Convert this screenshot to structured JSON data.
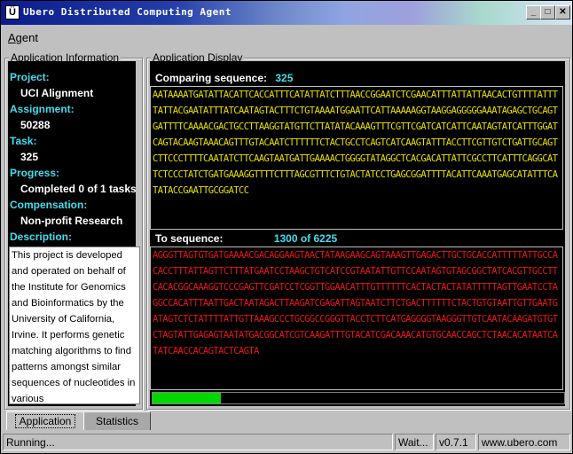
{
  "window": {
    "title": "Ubero Distributed Computing Agent",
    "app_icon": "Ü"
  },
  "menu": {
    "agent_label_first": "A",
    "agent_label_rest": "gent"
  },
  "info": {
    "group_title": "Application Information",
    "project_label": "Project:",
    "project_value": "UCI Alignment",
    "assignment_label": "Assignment:",
    "assignment_value": "50288",
    "task_label": "Task:",
    "task_value": "325",
    "progress_label": "Progress:",
    "progress_value": "Completed 0 of 1 tasks",
    "compensation_label": "Compensation:",
    "compensation_value": "Non-profit Research",
    "description_label": "Description:",
    "description_text": "This project is developed and operated on behalf of the Institute for Genomics and Bioinformatics by the University of California, Irvine.  It performs genetic matching algorithms to find patterns amongst similar sequences of nucleotides in various"
  },
  "display": {
    "group_title": "Application Display",
    "comparing_label": "Comparing sequence:",
    "comparing_value": "325",
    "comparing_sequence": "AATAAAATGATATTACATTCACCATTTCATATTATCTTTAACCGGAATCTCGAACATTTATTATTAACACTGTTTTATTTTATTACGAATATTTATCAATAGTACTTTCTGTAAAATGGAATTCATTAAAAAGGTAAGGAGGGGGAAATAGAGCTGCAGTGATTTTCAAAACGACTGCCTTAAGGTATGTTCTTATATACAAAGTTTCGTTCGATCATCATTCAATAGTATCATTTGGATCAGTACAAGTAAACAGTTTGTACAATCTTTTTTCTACTGCCTCAGTCATCAAGTATTTACCTTCGTTGTCTGATTGCAGTCTTCCCTTTTCAATATCTTCAAGTAATGATTGAAAACTGGGGTATAGGCTCACGACATTATTCGCCTTCATTTCAGGCATTCTCCCTATCTGATGAAAGGTTTTCTTTAGCGTTTCTGTACTATCCTGAGCGGATTTTACATTCAAATGAGCATATTTCATATACCGAATTGCGGATCC",
    "to_label": "To sequence:",
    "to_value": "1300 of 6225",
    "to_sequence": "AGGGTTAGTGTGATGAAAACGACAGGAAGTAACTATAAGAAGCAGTAAAGTTGAGACTTGCTGCACCATTTTTATTGCCACACCTTTATTAGTTCTTTATGAATCCTAAGCTGTCATCCGTAATATTGTTCCAATAGTGTAGCGGCTATCACGTTGCCTTCACACGGCAAAGGTCCCGAGTTCGATCCTCGGTTGGAACATTTGTTTTTTCACTACTACTATATTTTTAGTTGAATCCTAGGCCACATTTAATTGACTAATAGACTTAAGATCGAGATTAGTAATCTTCTGACTTTTTTCTACTGTGTAATTGTTGAATGATAGTCTCTATTTTATTGTTAAAGCCCTGCGGCCGGGTTACCTCTTCATGAGGGGTAAGGGTTGTCAATACAAGATGTGTCTAGTATTGAGAGTAATATGACGGCATCGTCAAGATTTGTACATCGACAAACATGTGCAACCAGCTCTAACACATAATCATATCAACCACAGTACTCAGTA",
    "progress_fraction": 0.165
  },
  "tabs": [
    {
      "label": "Application",
      "active": true
    },
    {
      "label": "Statistics",
      "active": false
    }
  ],
  "status": {
    "message": "Running...",
    "state": "Wait...",
    "version": "v0.7.1",
    "site": "www.ubero.com"
  },
  "colors": {
    "label_cyan": "#44ddee",
    "seq_compare": "#e8e000",
    "seq_target": "#e8141c",
    "progress_green": "#00d800"
  }
}
